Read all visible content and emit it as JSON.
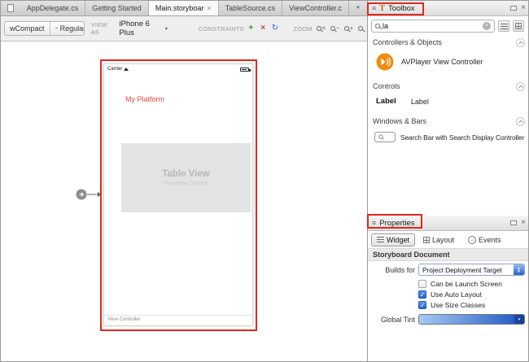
{
  "colors": {
    "annotation_red": "#e0281c",
    "accent_orange": "#ee8d13",
    "checkbox_blue": "#2f63cb",
    "canvas_label_red": "#e8463c"
  },
  "tab_bar": {
    "tabs": [
      {
        "label": "AppDelegate.cs",
        "active": false
      },
      {
        "label": "Getting Started",
        "active": false
      },
      {
        "label": "Main.storyboar",
        "active": true
      },
      {
        "label": "TableSource.cs",
        "active": false
      },
      {
        "label": "ViewController.c",
        "active": false
      }
    ]
  },
  "toolbar": {
    "size_class": {
      "left": "wCompact",
      "right": "Regular"
    },
    "view_as_label": "VIEW AS",
    "device": "iPhone 6 Plus",
    "constraints_label": "CONSTRAINTS",
    "zoom_label": "ZOOM"
  },
  "canvas": {
    "carrier": "Carrier",
    "title": "My Platform",
    "table_view_title": "Table View",
    "table_view_subtitle": "Prototype Content",
    "footer": "View Controller"
  },
  "toolbox": {
    "title": "Toolbox",
    "search_value": "la",
    "sections": [
      {
        "title": "Controllers & Objects"
      },
      {
        "title": "Controls"
      },
      {
        "title": "Windows & Bars"
      }
    ],
    "items": {
      "avplayer": "AVPlayer View Controller",
      "label_icon": "Label",
      "label_name": "Label",
      "searchbar": "Search Bar with Search Display Controller"
    }
  },
  "properties": {
    "title": "Properties",
    "tabs": {
      "widget": "Widget",
      "layout": "Layout",
      "events": "Events"
    },
    "section": "Storyboard Document",
    "builds_for_label": "Builds for",
    "builds_for_value": "Project Deployment Target",
    "checkboxes": [
      {
        "label": "Can be Launch Screen",
        "checked": false
      },
      {
        "label": "Use Auto Layout",
        "checked": true
      },
      {
        "label": "Use Size Classes",
        "checked": true
      }
    ],
    "global_tint_label": "Global Tint"
  },
  "icons": {
    "tab_close": "×",
    "tab_overflow": "▼",
    "size_class_sep": "×",
    "dropdown_arrow": "▾",
    "constraint_add": "+",
    "constraint_clear": "×",
    "constraint_update": "↻",
    "zoom_fit": "=",
    "zoom_out": "−",
    "zoom_in": "+",
    "hamburger": "≡",
    "toolbox_glyph": "T",
    "pad_close": "×",
    "search_clear": "×",
    "popup_up": "▲",
    "popup_down": "▼",
    "events_arrow": "→",
    "check": "✓"
  }
}
